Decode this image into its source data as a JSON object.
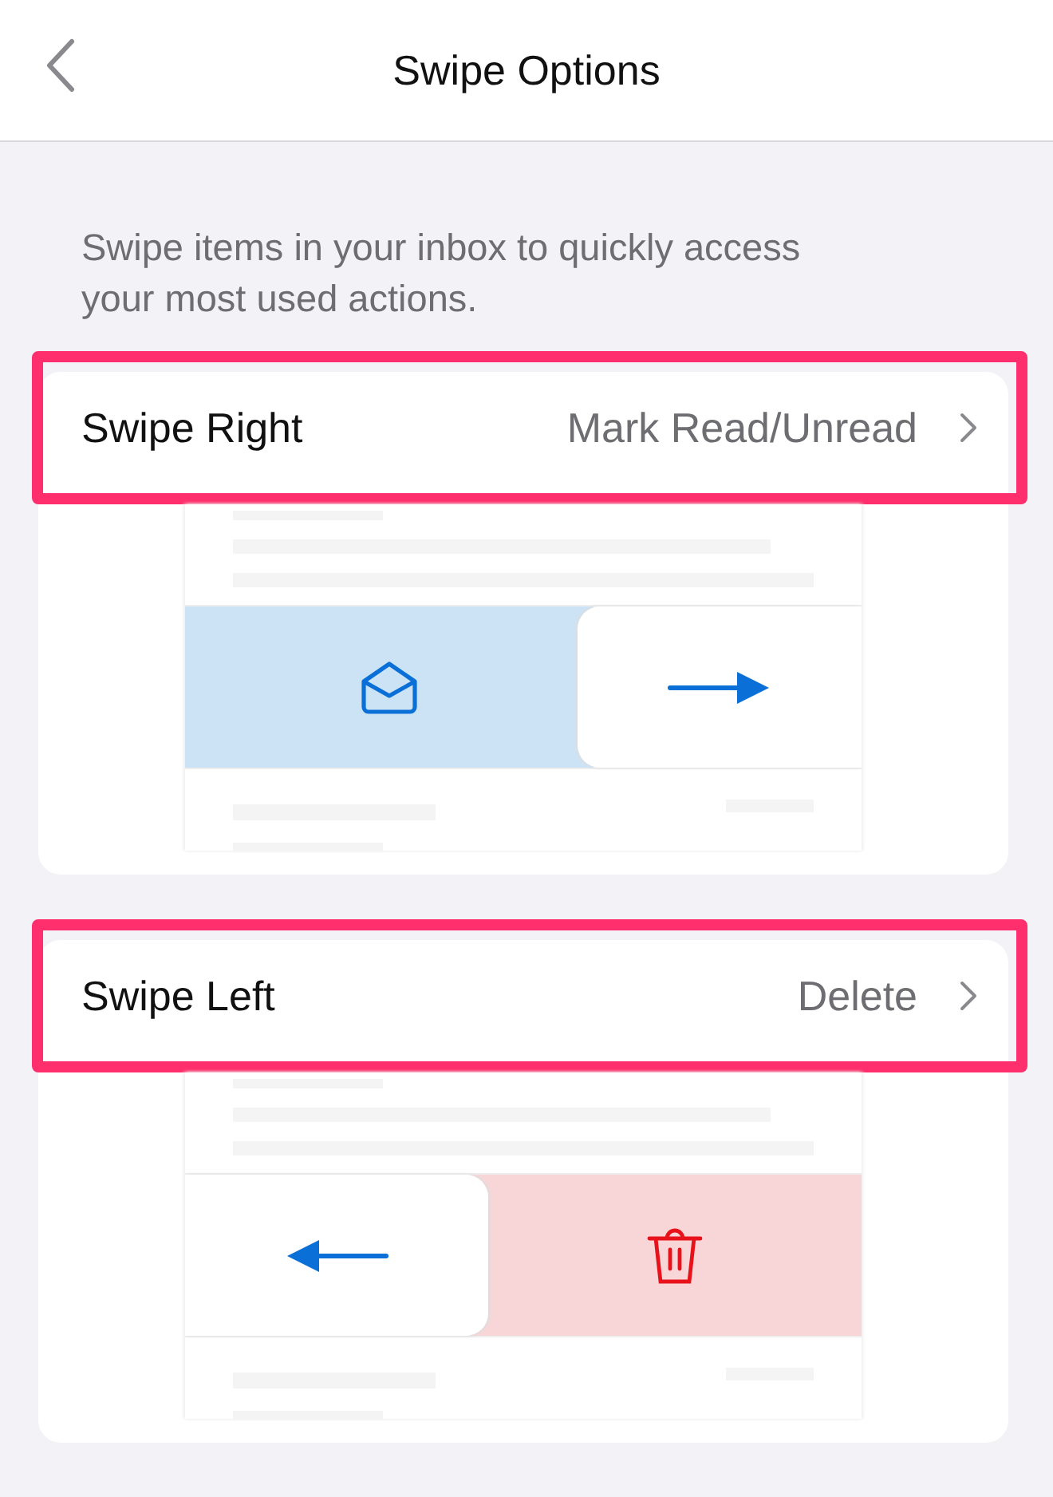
{
  "header": {
    "title": "Swipe Options"
  },
  "description": "Swipe items in your inbox to quickly access your most used actions.",
  "options": [
    {
      "label": "Swipe Right",
      "value": "Mark Read/Unread",
      "highlighted": true,
      "kind": "read"
    },
    {
      "label": "Swipe Left",
      "value": "Delete",
      "highlighted": true,
      "kind": "delete"
    }
  ]
}
